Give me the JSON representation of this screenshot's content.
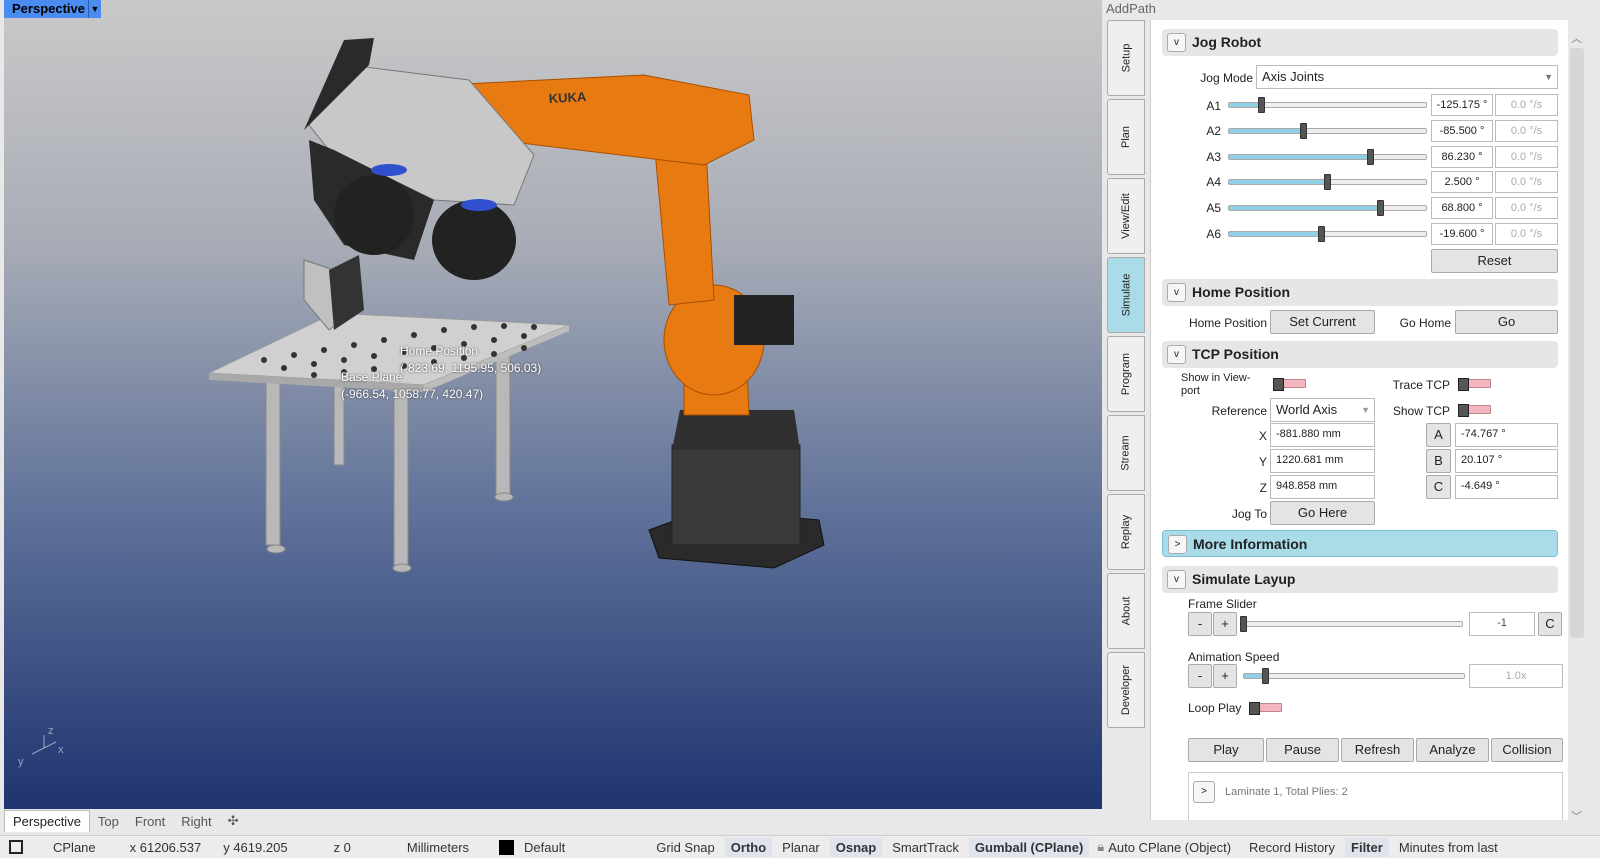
{
  "viewport": {
    "name": "Perspective",
    "annotations": {
      "home_label": "Home Position",
      "home_coords": "(-823.69, 1195.95, 506.03)",
      "base_label": "Base Plane",
      "base_coords": "(-966.54, 1058.77, 420.47)"
    },
    "robot_brand": "KUKA",
    "axis_labels": {
      "x": "x",
      "y": "y",
      "z": "z"
    },
    "tabs": [
      "Perspective",
      "Top",
      "Front",
      "Right"
    ],
    "add_tab_icon": "plus-icon"
  },
  "panel": {
    "title": "AddPath",
    "side_tabs": [
      "Setup",
      "Plan",
      "View/Edit",
      "Simulate",
      "Program",
      "Stream",
      "Replay",
      "About",
      "Developer"
    ],
    "active_tab": "Simulate",
    "jog": {
      "title": "Jog Robot",
      "mode_label": "Jog Mode",
      "mode_value": "Axis Joints",
      "axes": [
        {
          "name": "A1",
          "value": "-125.175 °",
          "speed": "0.0 °/s",
          "level": 0.17
        },
        {
          "name": "A2",
          "value": "-85.500 °",
          "speed": "0.0 °/s",
          "level": 0.38
        },
        {
          "name": "A3",
          "value": "86.230 °",
          "speed": "0.0 °/s",
          "level": 0.72
        },
        {
          "name": "A4",
          "value": "2.500 °",
          "speed": "0.0 °/s",
          "level": 0.5
        },
        {
          "name": "A5",
          "value": "68.800 °",
          "speed": "0.0 °/s",
          "level": 0.77
        },
        {
          "name": "A6",
          "value": "-19.600 °",
          "speed": "0.0 °/s",
          "level": 0.47
        }
      ],
      "reset_label": "Reset"
    },
    "home": {
      "title": "Home Position",
      "label": "Home Position",
      "set_current_label": "Set Current",
      "go_home_label": "Go Home",
      "go_label": "Go"
    },
    "tcp": {
      "title": "TCP Position",
      "show_viewport_label": "Show in View-port",
      "trace_label": "Trace TCP",
      "reference_label": "Reference",
      "reference_value": "World Axis",
      "show_tcp_label": "Show TCP",
      "x_label": "X",
      "x_value": "-881.880 mm",
      "y_label": "Y",
      "y_value": "1220.681 mm",
      "z_label": "Z",
      "z_value": "948.858 mm",
      "a_label": "A",
      "a_value": "-74.767 °",
      "b_label": "B",
      "b_value": "20.107 °",
      "c_label": "C",
      "c_value": "-4.649 °",
      "jog_to_label": "Jog To",
      "go_here_label": "Go Here"
    },
    "more_info": {
      "title": "More Information"
    },
    "layup": {
      "title": "Simulate Layup",
      "frame_slider_label": "Frame Slider",
      "minus": "-",
      "plus": "+",
      "frame_value": "-1",
      "c_label": "C",
      "frame_level": 0.0,
      "anim_speed_label": "Animation Speed",
      "anim_speed_value": "1.0x",
      "anim_level": 0.1,
      "loop_label": "Loop Play",
      "buttons": [
        "Play",
        "Pause",
        "Refresh",
        "Analyze",
        "Collision"
      ],
      "laminate_text": "Laminate 1, Total Plies: 2"
    }
  },
  "statusbar": {
    "cplane": "CPlane",
    "x": "x 61206.537",
    "y": "y 4619.205",
    "z": "z 0",
    "units": "Millimeters",
    "layer": "Default",
    "layer_color": "#000000",
    "toggles": [
      {
        "label": "Grid Snap",
        "on": false
      },
      {
        "label": "Ortho",
        "on": true
      },
      {
        "label": "Planar",
        "on": false
      },
      {
        "label": "Osnap",
        "on": true
      },
      {
        "label": "SmartTrack",
        "on": false
      },
      {
        "label": "Gumball (CPlane)",
        "on": true
      }
    ],
    "lock_icon": "lock-icon",
    "auto_cplane": "Auto CPlane (Object)",
    "record_history": "Record History",
    "filter": "Filter",
    "minutes": "Minutes from last"
  },
  "colors": {
    "accent": "#4a8cf0",
    "active_tab": "#a9dbe8",
    "robot": "#e87a12",
    "slider": "#8fd0e6",
    "toggle": "#f4b5c1"
  }
}
